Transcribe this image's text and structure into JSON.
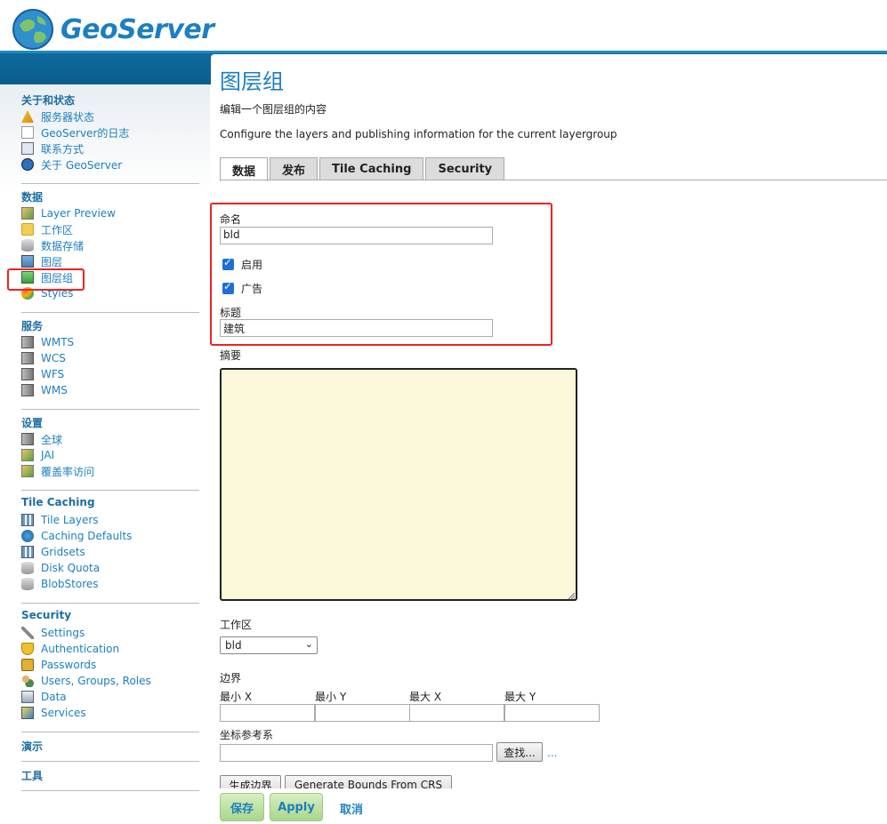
{
  "header": {
    "brand": "GeoServer"
  },
  "sidebar": {
    "sections": [
      {
        "title": "关于和状态",
        "items": [
          {
            "label": "服务器状态",
            "icon": "warning-icon"
          },
          {
            "label": "GeoServer的日志",
            "icon": "document-icon"
          },
          {
            "label": "联系方式",
            "icon": "contact-card-icon"
          },
          {
            "label": "关于 GeoServer",
            "icon": "info-icon"
          }
        ]
      },
      {
        "title": "数据",
        "items": [
          {
            "label": "Layer Preview",
            "icon": "map-preview-icon"
          },
          {
            "label": "工作区",
            "icon": "folder-icon"
          },
          {
            "label": "数据存储",
            "icon": "database-icon"
          },
          {
            "label": "图层",
            "icon": "layer-icon"
          },
          {
            "label": "图层组",
            "icon": "layer-group-icon"
          },
          {
            "label": "Styles",
            "icon": "palette-icon"
          }
        ]
      },
      {
        "title": "服务",
        "items": [
          {
            "label": "WMTS",
            "icon": "server-icon"
          },
          {
            "label": "WCS",
            "icon": "server-icon"
          },
          {
            "label": "WFS",
            "icon": "server-icon"
          },
          {
            "label": "WMS",
            "icon": "server-icon"
          }
        ]
      },
      {
        "title": "设置",
        "items": [
          {
            "label": "全球",
            "icon": "server-icon"
          },
          {
            "label": "JAI",
            "icon": "map-preview-icon"
          },
          {
            "label": "覆盖率访问",
            "icon": "map-preview-icon"
          }
        ]
      },
      {
        "title": "Tile Caching",
        "items": [
          {
            "label": "Tile Layers",
            "icon": "grid-icon"
          },
          {
            "label": "Caching Defaults",
            "icon": "globe-icon"
          },
          {
            "label": "Gridsets",
            "icon": "grid-icon"
          },
          {
            "label": "Disk Quota",
            "icon": "database-icon"
          },
          {
            "label": "BlobStores",
            "icon": "database-icon"
          }
        ]
      },
      {
        "title": "Security",
        "items": [
          {
            "label": "Settings",
            "icon": "wrench-icon"
          },
          {
            "label": "Authentication",
            "icon": "shield-icon"
          },
          {
            "label": "Passwords",
            "icon": "lock-icon"
          },
          {
            "label": "Users, Groups, Roles",
            "icon": "users-icon"
          },
          {
            "label": "Data",
            "icon": "data-icon"
          },
          {
            "label": "Services",
            "icon": "services-icon"
          }
        ]
      },
      {
        "title": "演示",
        "items": []
      },
      {
        "title": "工具",
        "items": []
      }
    ]
  },
  "main": {
    "title": "图层组",
    "subtitle": "编辑一个图层组的内容",
    "description": "Configure the layers and publishing information for the current layergroup",
    "tabs": [
      {
        "label": "数据",
        "active": true
      },
      {
        "label": "发布",
        "active": false
      },
      {
        "label": "Tile Caching",
        "active": false
      },
      {
        "label": "Security",
        "active": false
      }
    ],
    "form": {
      "name_label": "命名",
      "name_value": "bld",
      "enabled_label": "启用",
      "enabled": true,
      "advertised_label": "广告",
      "advertised": true,
      "title_label": "标题",
      "title_value": "建筑",
      "abstract_label": "摘要",
      "abstract_value": "",
      "workspace_label": "工作区",
      "workspace_value": "bld",
      "bounds_label": "边界",
      "bounds_cols": [
        "最小 X",
        "最小 Y",
        "最大 X",
        "最大 Y"
      ],
      "crs_label": "坐标参考系",
      "crs_value": "",
      "find_button": "查找...",
      "crs_more": "...",
      "generate_bounds_button": "生成边界",
      "generate_bounds_crs_button": "Generate Bounds From CRS"
    },
    "actions": {
      "save": "保存",
      "apply": "Apply",
      "cancel": "取消"
    }
  },
  "colors": {
    "accent": "#1c7fc1",
    "header_bar": "#0e6c9e",
    "highlight": "#e22222",
    "abstract_bg": "#fbf7d9"
  }
}
